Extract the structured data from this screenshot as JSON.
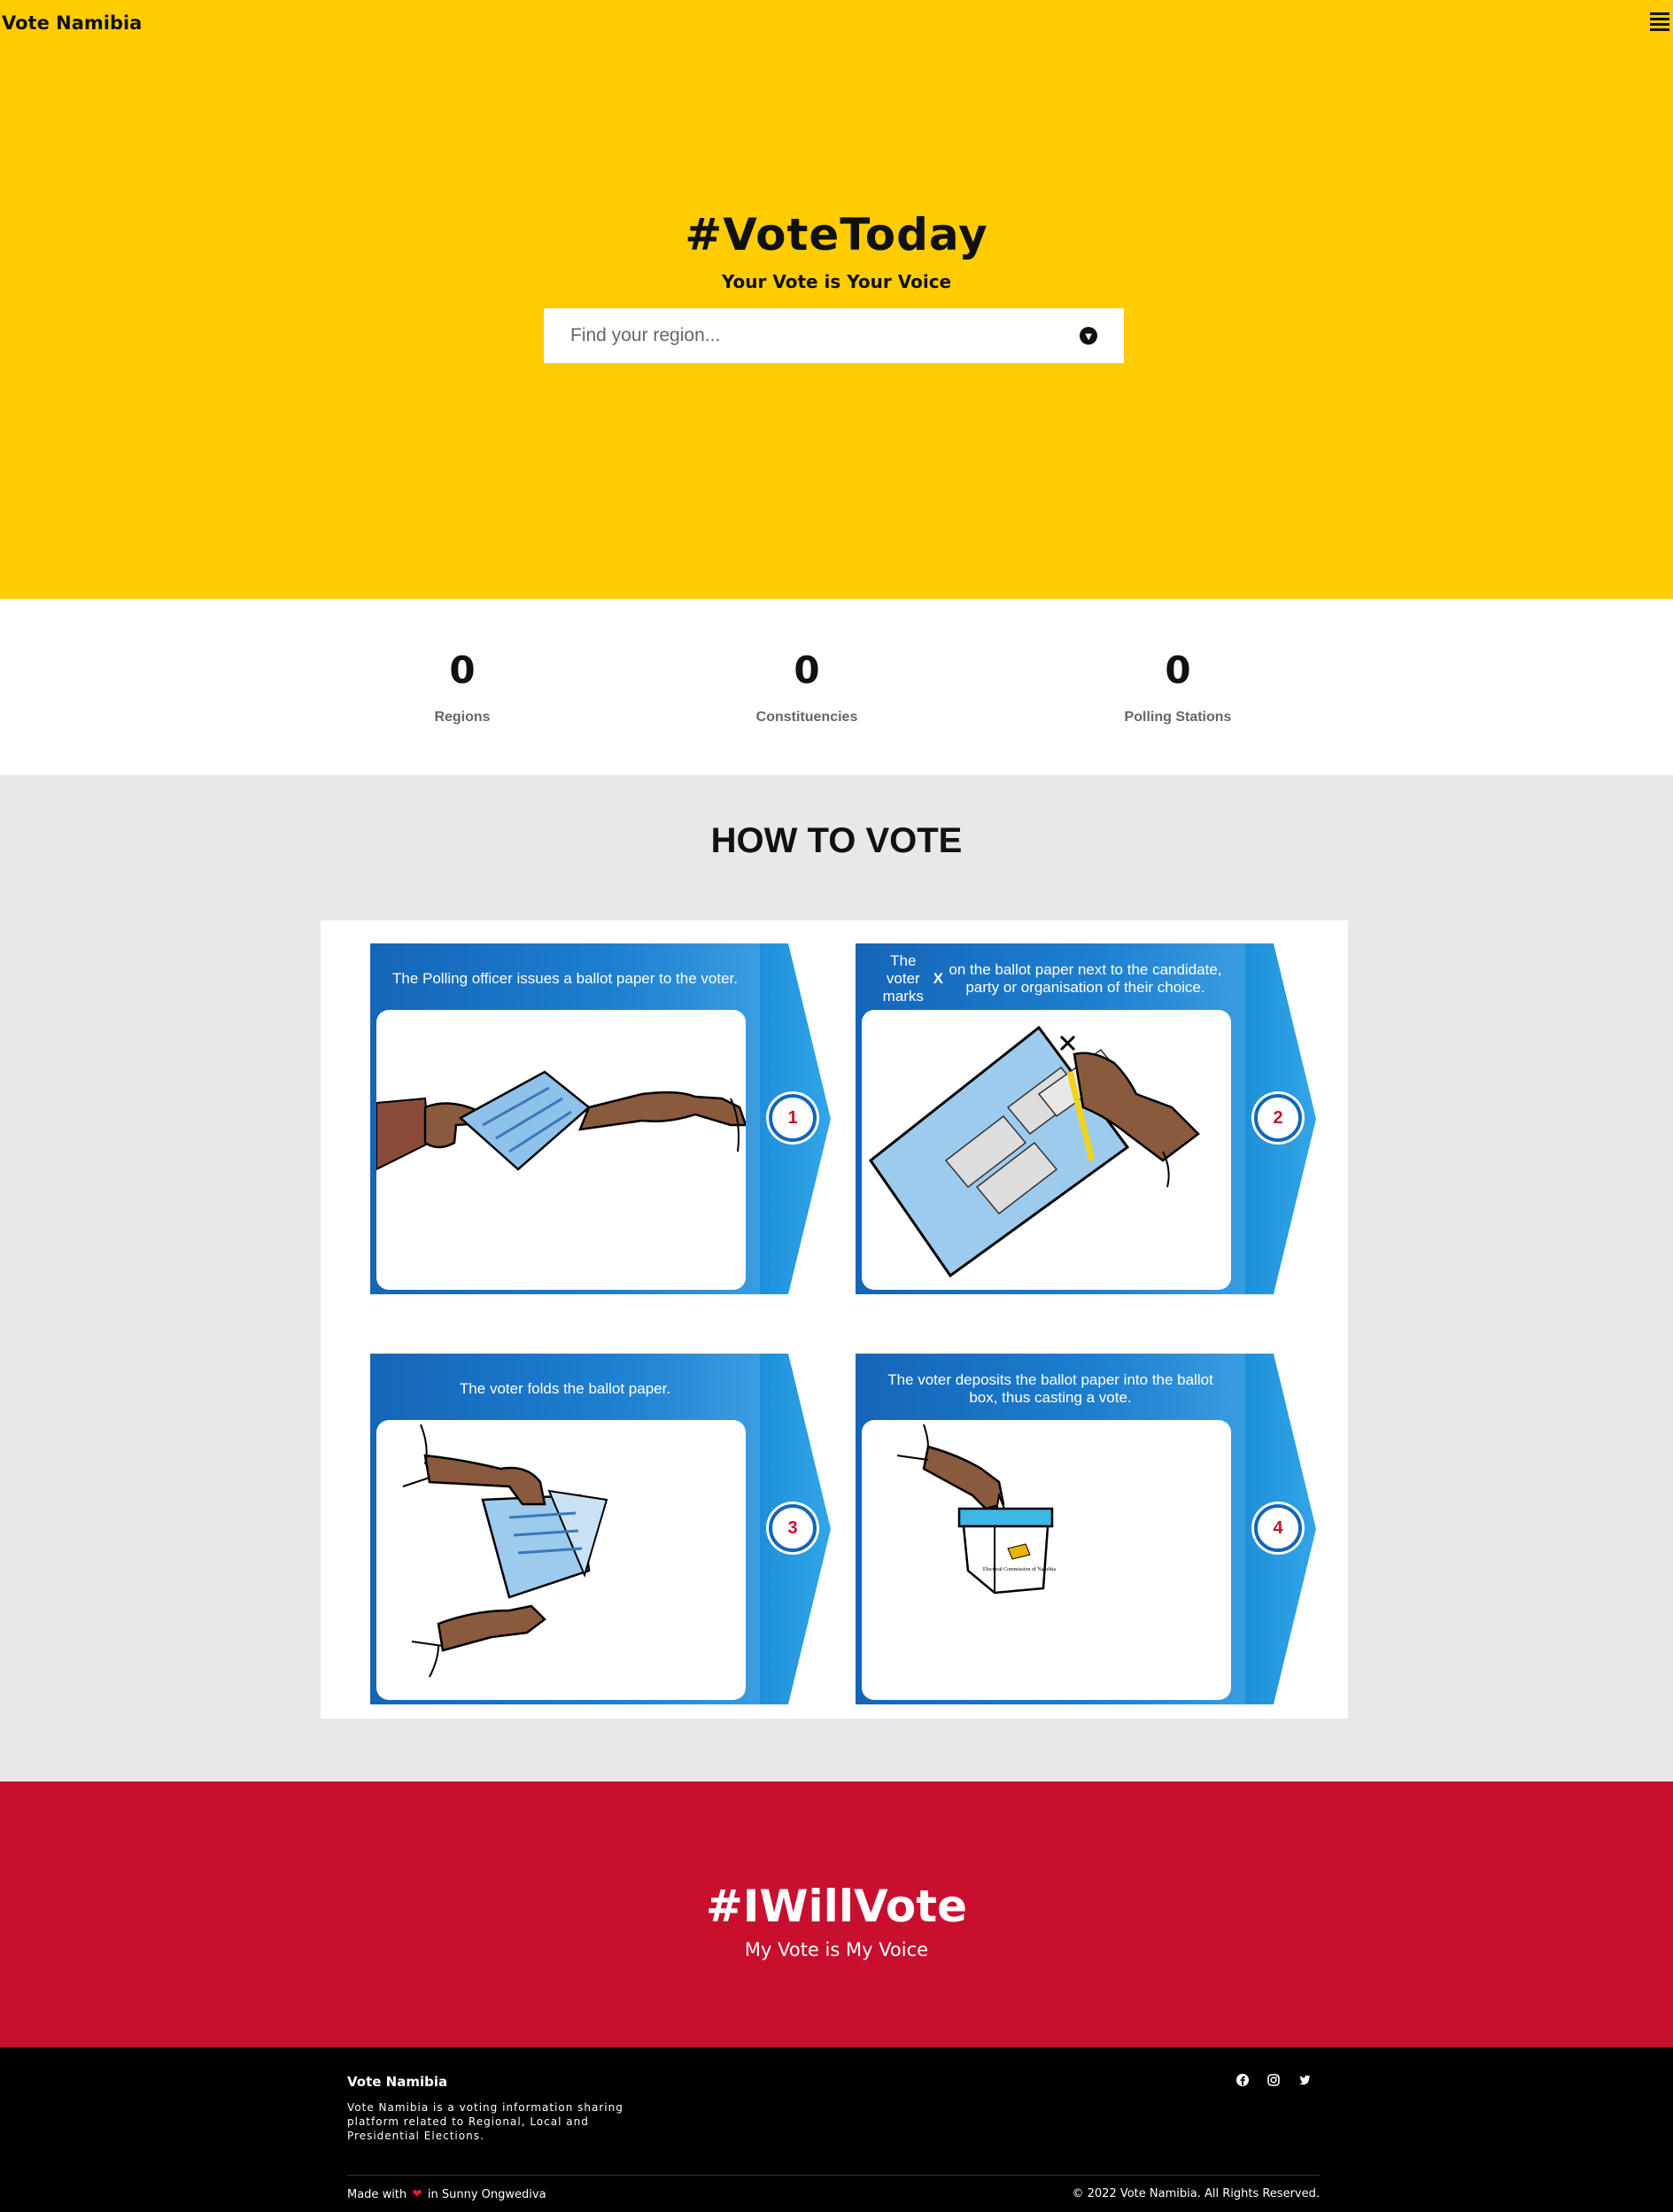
{
  "header": {
    "brand": "Vote Namibia",
    "menu_icon": "hamburger-menu-icon"
  },
  "hero": {
    "title": "#VoteToday",
    "subtitle": "Your Vote is Your Voice",
    "search": {
      "placeholder": "Find your region...",
      "icon": "chevron-down-circle-icon"
    },
    "background_color": "#ffcc02"
  },
  "stats": [
    {
      "value": "0",
      "label": "Regions"
    },
    {
      "value": "0",
      "label": "Constituencies"
    },
    {
      "value": "0",
      "label": "Polling Stations"
    }
  ],
  "how_to_vote": {
    "title": "HOW TO VOTE",
    "steps": [
      {
        "number": "1",
        "caption": "The Polling officer issues a ballot paper to the voter.",
        "illustration": "hands-passing-ballot-illustration"
      },
      {
        "number": "2",
        "caption_pre": "The voter marks ",
        "caption_bold": "X",
        "caption_post": " on the ballot paper next to the candidate, party or organisation of their choice.",
        "illustration": "hand-marking-ballot-illustration"
      },
      {
        "number": "3",
        "caption": "The voter folds the ballot paper.",
        "illustration": "hands-folding-ballot-illustration"
      },
      {
        "number": "4",
        "caption": "The voter deposits the ballot paper into the ballot box, thus casting a vote.",
        "illustration": "hand-depositing-ballot-illustration"
      }
    ],
    "ballot_box_label": "Electoral Commission of Namibia"
  },
  "banner": {
    "title": "#IWillVote",
    "subtitle": "My Vote is My Voice",
    "background_color": "#c8102e"
  },
  "footer": {
    "brand": "Vote Namibia",
    "description": "Vote Namibia is a voting information sharing platform related to Regional, Local and Presidential Elections.",
    "social_icons": [
      "facebook-icon",
      "instagram-icon",
      "twitter-icon"
    ],
    "made_with_prefix": "Made with",
    "made_with_suffix": "in Sunny Ongwediva",
    "copyright": "© 2022 Vote Namibia. All Rights Reserved."
  }
}
